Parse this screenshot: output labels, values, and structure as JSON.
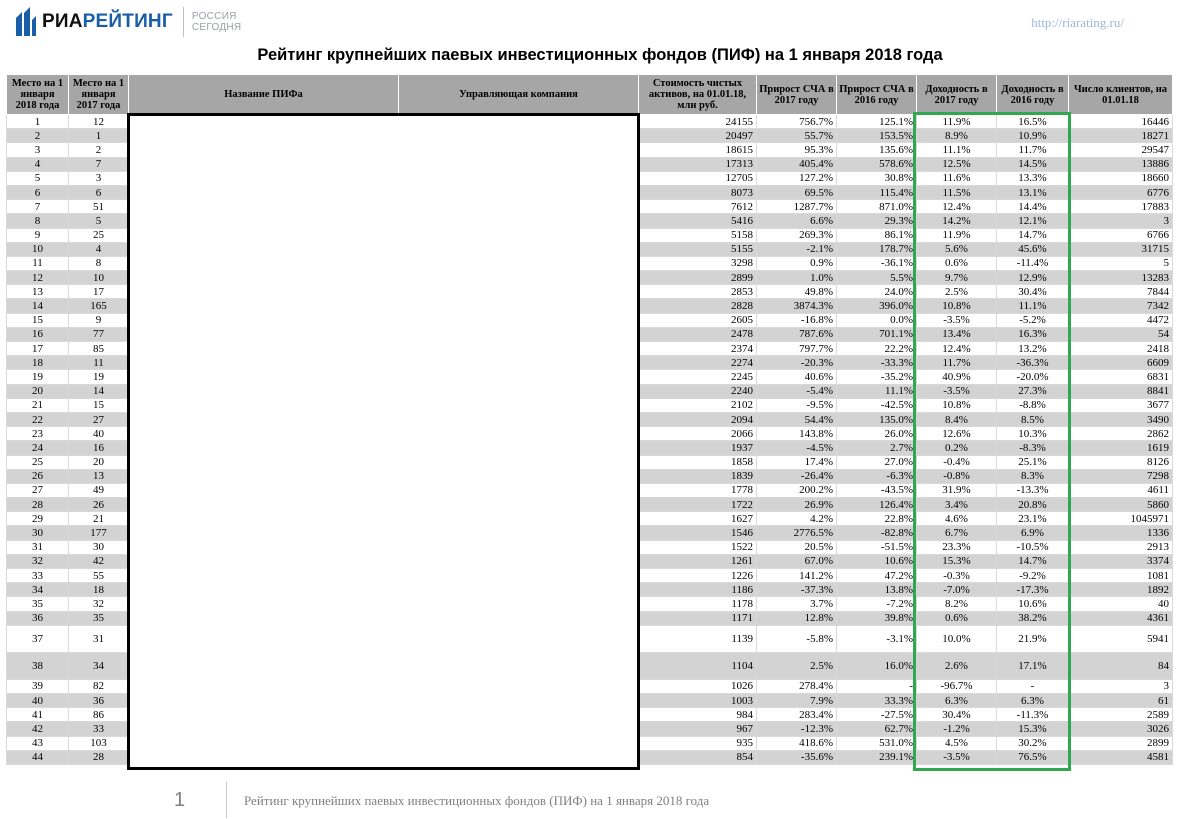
{
  "logo": {
    "brand_part1": "РИА",
    "brand_part2": "РЕЙТИНГ",
    "partner_line1": "РОССИЯ",
    "partner_line2": "СЕГОДНЯ"
  },
  "site_url": "http://riarating.ru/",
  "title": "Рейтинг крупнейших паевых инвестиционных фондов (ПИФ) на 1 января 2018 года",
  "headers": [
    "Место на 1 января 2018 года",
    "Место на 1 января 2017 года",
    "Название ПИФа",
    "Управляющая компания",
    "Стоимость чистых активов, на 01.01.18, млн руб.",
    "Прирост СЧА в 2017 году",
    "Прирост СЧА в 2016 году",
    "Доходность в 2017 году",
    "Доходность в 2016 году",
    "Число клиентов, на 01.01.18"
  ],
  "rows": [
    [
      "1",
      "12",
      "24155",
      "756.7%",
      "125.1%",
      "11.9%",
      "16.5%",
      "16446"
    ],
    [
      "2",
      "1",
      "20497",
      "55.7%",
      "153.5%",
      "8.9%",
      "10.9%",
      "18271"
    ],
    [
      "3",
      "2",
      "18615",
      "95.3%",
      "135.6%",
      "11.1%",
      "11.7%",
      "29547"
    ],
    [
      "4",
      "7",
      "17313",
      "405.4%",
      "578.6%",
      "12.5%",
      "14.5%",
      "13886"
    ],
    [
      "5",
      "3",
      "12705",
      "127.2%",
      "30.8%",
      "11.6%",
      "13.3%",
      "18660"
    ],
    [
      "6",
      "6",
      "8073",
      "69.5%",
      "115.4%",
      "11.5%",
      "13.1%",
      "6776"
    ],
    [
      "7",
      "51",
      "7612",
      "1287.7%",
      "871.0%",
      "12.4%",
      "14.4%",
      "17883"
    ],
    [
      "8",
      "5",
      "5416",
      "6.6%",
      "29.3%",
      "14.2%",
      "12.1%",
      "3"
    ],
    [
      "9",
      "25",
      "5158",
      "269.3%",
      "86.1%",
      "11.9%",
      "14.7%",
      "6766"
    ],
    [
      "10",
      "4",
      "5155",
      "-2.1%",
      "178.7%",
      "5.6%",
      "45.6%",
      "31715"
    ],
    [
      "11",
      "8",
      "3298",
      "0.9%",
      "-36.1%",
      "0.6%",
      "-11.4%",
      "5"
    ],
    [
      "12",
      "10",
      "2899",
      "1.0%",
      "5.5%",
      "9.7%",
      "12.9%",
      "13283"
    ],
    [
      "13",
      "17",
      "2853",
      "49.8%",
      "24.0%",
      "2.5%",
      "30.4%",
      "7844"
    ],
    [
      "14",
      "165",
      "2828",
      "3874.3%",
      "396.0%",
      "10.8%",
      "11.1%",
      "7342"
    ],
    [
      "15",
      "9",
      "2605",
      "-16.8%",
      "0.0%",
      "-3.5%",
      "-5.2%",
      "4472"
    ],
    [
      "16",
      "77",
      "2478",
      "787.6%",
      "701.1%",
      "13.4%",
      "16.3%",
      "54"
    ],
    [
      "17",
      "85",
      "2374",
      "797.7%",
      "22.2%",
      "12.4%",
      "13.2%",
      "2418"
    ],
    [
      "18",
      "11",
      "2274",
      "-20.3%",
      "-33.3%",
      "11.7%",
      "-36.3%",
      "6609"
    ],
    [
      "19",
      "19",
      "2245",
      "40.6%",
      "-35.2%",
      "40.9%",
      "-20.0%",
      "6831"
    ],
    [
      "20",
      "14",
      "2240",
      "-5.4%",
      "11.1%",
      "-3.5%",
      "27.3%",
      "8841"
    ],
    [
      "21",
      "15",
      "2102",
      "-9.5%",
      "-42.5%",
      "10.8%",
      "-8.8%",
      "3677"
    ],
    [
      "22",
      "27",
      "2094",
      "54.4%",
      "135.0%",
      "8.4%",
      "8.5%",
      "3490"
    ],
    [
      "23",
      "40",
      "2066",
      "143.8%",
      "26.0%",
      "12.6%",
      "10.3%",
      "2862"
    ],
    [
      "24",
      "16",
      "1937",
      "-4.5%",
      "2.7%",
      "0.2%",
      "-8.3%",
      "1619"
    ],
    [
      "25",
      "20",
      "1858",
      "17.4%",
      "27.0%",
      "-0.4%",
      "25.1%",
      "8126"
    ],
    [
      "26",
      "13",
      "1839",
      "-26.4%",
      "-6.3%",
      "-0.8%",
      "8.3%",
      "7298"
    ],
    [
      "27",
      "49",
      "1778",
      "200.2%",
      "-43.5%",
      "31.9%",
      "-13.3%",
      "4611"
    ],
    [
      "28",
      "26",
      "1722",
      "26.9%",
      "126.4%",
      "3.4%",
      "20.8%",
      "5860"
    ],
    [
      "29",
      "21",
      "1627",
      "4.2%",
      "22.8%",
      "4.6%",
      "23.1%",
      "1045971"
    ],
    [
      "30",
      "177",
      "1546",
      "2776.5%",
      "-82.8%",
      "6.7%",
      "6.9%",
      "1336"
    ],
    [
      "31",
      "30",
      "1522",
      "20.5%",
      "-51.5%",
      "23.3%",
      "-10.5%",
      "2913"
    ],
    [
      "32",
      "42",
      "1261",
      "67.0%",
      "10.6%",
      "15.3%",
      "14.7%",
      "3374"
    ],
    [
      "33",
      "55",
      "1226",
      "141.2%",
      "47.2%",
      "-0.3%",
      "-9.2%",
      "1081"
    ],
    [
      "34",
      "18",
      "1186",
      "-37.3%",
      "13.8%",
      "-7.0%",
      "-17.3%",
      "1892"
    ],
    [
      "35",
      "32",
      "1178",
      "3.7%",
      "-7.2%",
      "8.2%",
      "10.6%",
      "40"
    ],
    [
      "36",
      "35",
      "1171",
      "12.8%",
      "39.8%",
      "0.6%",
      "38.2%",
      "4361"
    ],
    [
      "37",
      "31",
      "1139",
      "-5.8%",
      "-3.1%",
      "10.0%",
      "21.9%",
      "5941"
    ],
    [
      "38",
      "34",
      "1104",
      "2.5%",
      "16.0%",
      "2.6%",
      "17.1%",
      "84"
    ],
    [
      "39",
      "82",
      "1026",
      "278.4%",
      "-",
      "-96.7%",
      "-",
      "3"
    ],
    [
      "40",
      "36",
      "1003",
      "7.9%",
      "33.3%",
      "6.3%",
      "6.3%",
      "61"
    ],
    [
      "41",
      "86",
      "984",
      "283.4%",
      "-27.5%",
      "30.4%",
      "-11.3%",
      "2589"
    ],
    [
      "42",
      "33",
      "967",
      "-12.3%",
      "62.7%",
      "-1.2%",
      "15.3%",
      "3026"
    ],
    [
      "43",
      "103",
      "935",
      "418.6%",
      "531.0%",
      "4.5%",
      "30.2%",
      "2899"
    ],
    [
      "44",
      "28",
      "854",
      "-35.6%",
      "239.1%",
      "-3.5%",
      "76.5%",
      "4581"
    ]
  ],
  "footer": {
    "page_number": "1",
    "text": "Рейтинг крупнейших паевых инвестиционных фондов (ПИФ) на 1 января 2018 года"
  }
}
